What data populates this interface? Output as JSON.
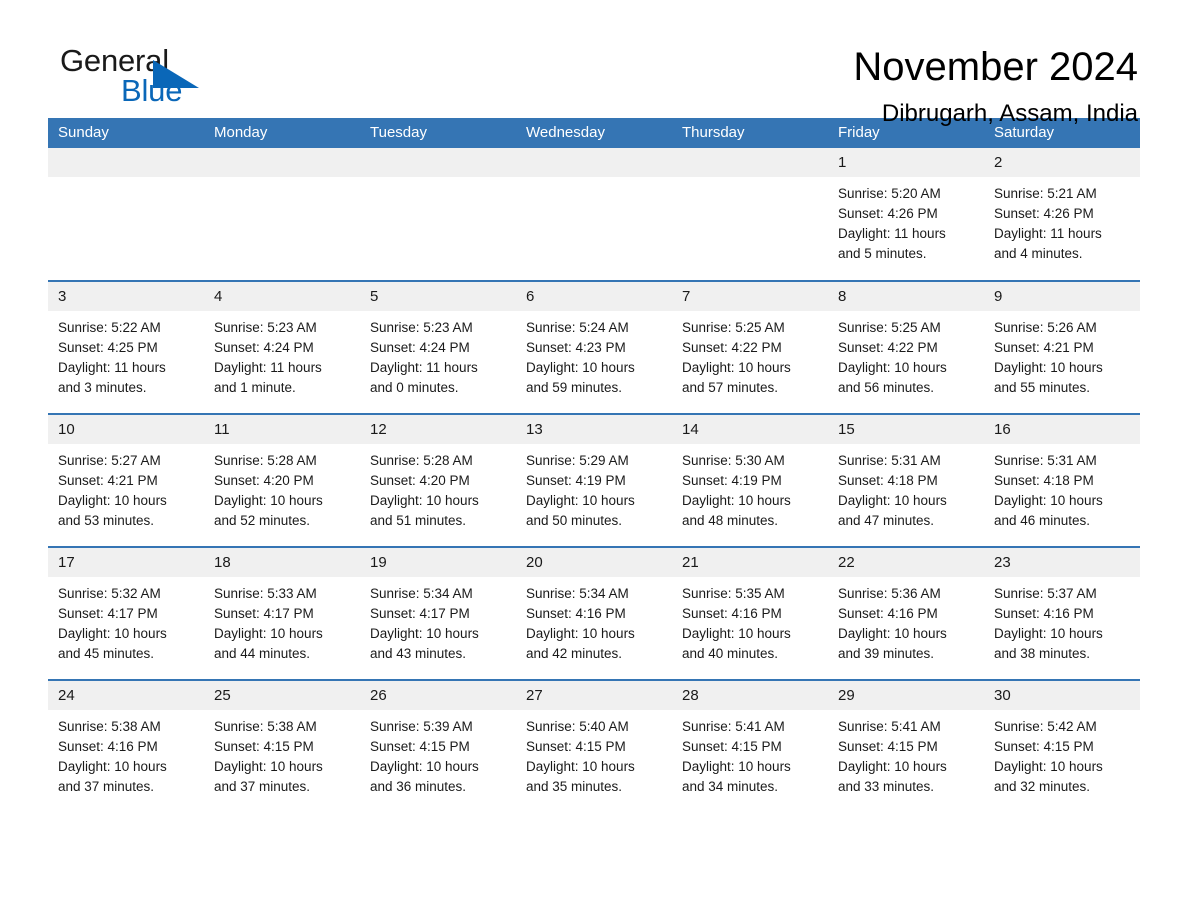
{
  "brand": {
    "name_part1": "General",
    "name_part2": "Blue",
    "logo_icon": "triangle-flag-icon",
    "accent_color": "#0a67b8"
  },
  "header": {
    "title": "November 2024",
    "subtitle": "Dibrugarh, Assam, India"
  },
  "theme": {
    "header_blue": "#3575b4",
    "daynum_gray": "#f0f0f0",
    "text_black": "#1a1a1a"
  },
  "labels": {
    "sunrise_prefix": "Sunrise:",
    "sunset_prefix": "Sunset:",
    "daylight_prefix": "Daylight:"
  },
  "weekdays": [
    "Sunday",
    "Monday",
    "Tuesday",
    "Wednesday",
    "Thursday",
    "Friday",
    "Saturday"
  ],
  "weeks": [
    [
      {
        "empty": true
      },
      {
        "empty": true
      },
      {
        "empty": true
      },
      {
        "empty": true
      },
      {
        "empty": true
      },
      {
        "day": "1",
        "sunrise": "Sunrise: 5:20 AM",
        "sunset": "Sunset: 4:26 PM",
        "daylight_line1": "Daylight: 11 hours",
        "daylight_line2": "and 5 minutes."
      },
      {
        "day": "2",
        "sunrise": "Sunrise: 5:21 AM",
        "sunset": "Sunset: 4:26 PM",
        "daylight_line1": "Daylight: 11 hours",
        "daylight_line2": "and 4 minutes."
      }
    ],
    [
      {
        "day": "3",
        "sunrise": "Sunrise: 5:22 AM",
        "sunset": "Sunset: 4:25 PM",
        "daylight_line1": "Daylight: 11 hours",
        "daylight_line2": "and 3 minutes."
      },
      {
        "day": "4",
        "sunrise": "Sunrise: 5:23 AM",
        "sunset": "Sunset: 4:24 PM",
        "daylight_line1": "Daylight: 11 hours",
        "daylight_line2": "and 1 minute."
      },
      {
        "day": "5",
        "sunrise": "Sunrise: 5:23 AM",
        "sunset": "Sunset: 4:24 PM",
        "daylight_line1": "Daylight: 11 hours",
        "daylight_line2": "and 0 minutes."
      },
      {
        "day": "6",
        "sunrise": "Sunrise: 5:24 AM",
        "sunset": "Sunset: 4:23 PM",
        "daylight_line1": "Daylight: 10 hours",
        "daylight_line2": "and 59 minutes."
      },
      {
        "day": "7",
        "sunrise": "Sunrise: 5:25 AM",
        "sunset": "Sunset: 4:22 PM",
        "daylight_line1": "Daylight: 10 hours",
        "daylight_line2": "and 57 minutes."
      },
      {
        "day": "8",
        "sunrise": "Sunrise: 5:25 AM",
        "sunset": "Sunset: 4:22 PM",
        "daylight_line1": "Daylight: 10 hours",
        "daylight_line2": "and 56 minutes."
      },
      {
        "day": "9",
        "sunrise": "Sunrise: 5:26 AM",
        "sunset": "Sunset: 4:21 PM",
        "daylight_line1": "Daylight: 10 hours",
        "daylight_line2": "and 55 minutes."
      }
    ],
    [
      {
        "day": "10",
        "sunrise": "Sunrise: 5:27 AM",
        "sunset": "Sunset: 4:21 PM",
        "daylight_line1": "Daylight: 10 hours",
        "daylight_line2": "and 53 minutes."
      },
      {
        "day": "11",
        "sunrise": "Sunrise: 5:28 AM",
        "sunset": "Sunset: 4:20 PM",
        "daylight_line1": "Daylight: 10 hours",
        "daylight_line2": "and 52 minutes."
      },
      {
        "day": "12",
        "sunrise": "Sunrise: 5:28 AM",
        "sunset": "Sunset: 4:20 PM",
        "daylight_line1": "Daylight: 10 hours",
        "daylight_line2": "and 51 minutes."
      },
      {
        "day": "13",
        "sunrise": "Sunrise: 5:29 AM",
        "sunset": "Sunset: 4:19 PM",
        "daylight_line1": "Daylight: 10 hours",
        "daylight_line2": "and 50 minutes."
      },
      {
        "day": "14",
        "sunrise": "Sunrise: 5:30 AM",
        "sunset": "Sunset: 4:19 PM",
        "daylight_line1": "Daylight: 10 hours",
        "daylight_line2": "and 48 minutes."
      },
      {
        "day": "15",
        "sunrise": "Sunrise: 5:31 AM",
        "sunset": "Sunset: 4:18 PM",
        "daylight_line1": "Daylight: 10 hours",
        "daylight_line2": "and 47 minutes."
      },
      {
        "day": "16",
        "sunrise": "Sunrise: 5:31 AM",
        "sunset": "Sunset: 4:18 PM",
        "daylight_line1": "Daylight: 10 hours",
        "daylight_line2": "and 46 minutes."
      }
    ],
    [
      {
        "day": "17",
        "sunrise": "Sunrise: 5:32 AM",
        "sunset": "Sunset: 4:17 PM",
        "daylight_line1": "Daylight: 10 hours",
        "daylight_line2": "and 45 minutes."
      },
      {
        "day": "18",
        "sunrise": "Sunrise: 5:33 AM",
        "sunset": "Sunset: 4:17 PM",
        "daylight_line1": "Daylight: 10 hours",
        "daylight_line2": "and 44 minutes."
      },
      {
        "day": "19",
        "sunrise": "Sunrise: 5:34 AM",
        "sunset": "Sunset: 4:17 PM",
        "daylight_line1": "Daylight: 10 hours",
        "daylight_line2": "and 43 minutes."
      },
      {
        "day": "20",
        "sunrise": "Sunrise: 5:34 AM",
        "sunset": "Sunset: 4:16 PM",
        "daylight_line1": "Daylight: 10 hours",
        "daylight_line2": "and 42 minutes."
      },
      {
        "day": "21",
        "sunrise": "Sunrise: 5:35 AM",
        "sunset": "Sunset: 4:16 PM",
        "daylight_line1": "Daylight: 10 hours",
        "daylight_line2": "and 40 minutes."
      },
      {
        "day": "22",
        "sunrise": "Sunrise: 5:36 AM",
        "sunset": "Sunset: 4:16 PM",
        "daylight_line1": "Daylight: 10 hours",
        "daylight_line2": "and 39 minutes."
      },
      {
        "day": "23",
        "sunrise": "Sunrise: 5:37 AM",
        "sunset": "Sunset: 4:16 PM",
        "daylight_line1": "Daylight: 10 hours",
        "daylight_line2": "and 38 minutes."
      }
    ],
    [
      {
        "day": "24",
        "sunrise": "Sunrise: 5:38 AM",
        "sunset": "Sunset: 4:16 PM",
        "daylight_line1": "Daylight: 10 hours",
        "daylight_line2": "and 37 minutes."
      },
      {
        "day": "25",
        "sunrise": "Sunrise: 5:38 AM",
        "sunset": "Sunset: 4:15 PM",
        "daylight_line1": "Daylight: 10 hours",
        "daylight_line2": "and 37 minutes."
      },
      {
        "day": "26",
        "sunrise": "Sunrise: 5:39 AM",
        "sunset": "Sunset: 4:15 PM",
        "daylight_line1": "Daylight: 10 hours",
        "daylight_line2": "and 36 minutes."
      },
      {
        "day": "27",
        "sunrise": "Sunrise: 5:40 AM",
        "sunset": "Sunset: 4:15 PM",
        "daylight_line1": "Daylight: 10 hours",
        "daylight_line2": "and 35 minutes."
      },
      {
        "day": "28",
        "sunrise": "Sunrise: 5:41 AM",
        "sunset": "Sunset: 4:15 PM",
        "daylight_line1": "Daylight: 10 hours",
        "daylight_line2": "and 34 minutes."
      },
      {
        "day": "29",
        "sunrise": "Sunrise: 5:41 AM",
        "sunset": "Sunset: 4:15 PM",
        "daylight_line1": "Daylight: 10 hours",
        "daylight_line2": "and 33 minutes."
      },
      {
        "day": "30",
        "sunrise": "Sunrise: 5:42 AM",
        "sunset": "Sunset: 4:15 PM",
        "daylight_line1": "Daylight: 10 hours",
        "daylight_line2": "and 32 minutes."
      }
    ]
  ]
}
